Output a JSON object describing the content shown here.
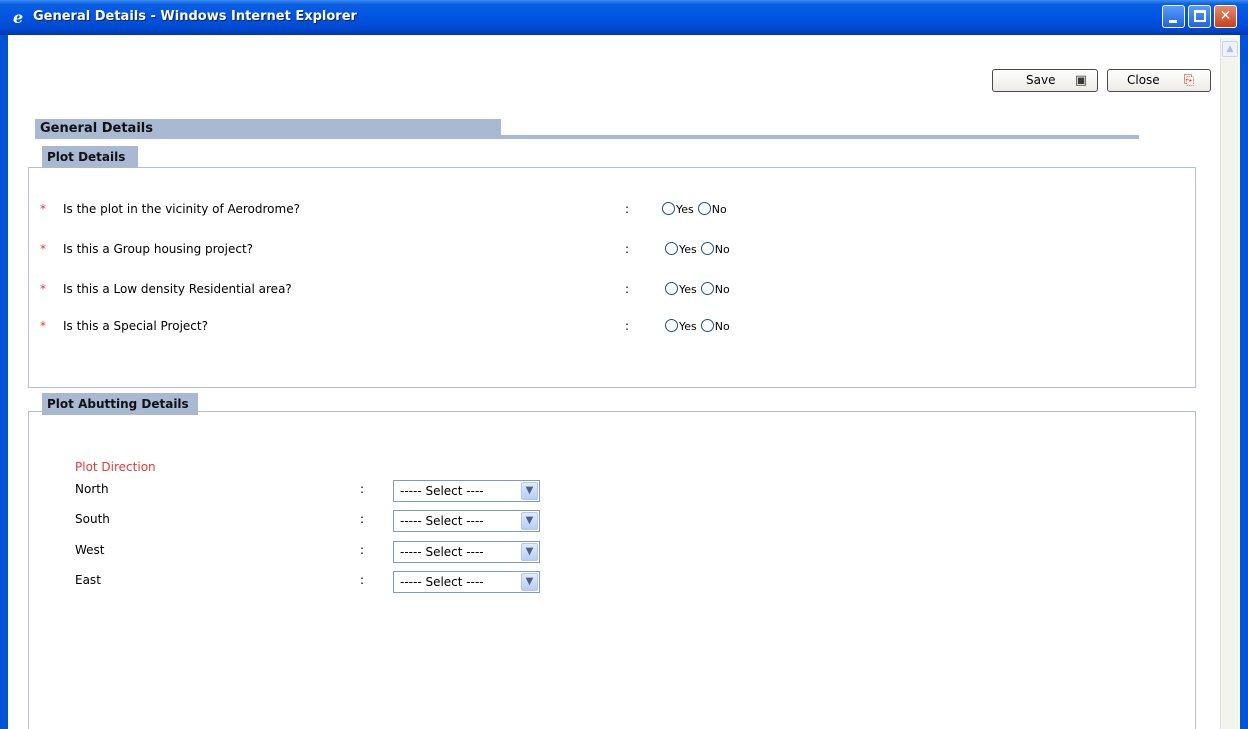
{
  "window": {
    "title": "General Details - Windows Internet Explorer",
    "minimize_glyph": "",
    "maximize_glyph": "",
    "close_glyph": "✕"
  },
  "toolbar": {
    "save_label": "Save",
    "close_label": "Close"
  },
  "section": {
    "title": "General Details"
  },
  "plot_details": {
    "legend": "Plot Details",
    "questions": [
      {
        "text": "Is the plot in the vicinity of Aerodrome?",
        "options": [
          "Yes",
          "No"
        ]
      },
      {
        "text": "Is this a Group housing project?",
        "options": [
          "Yes",
          "No"
        ]
      },
      {
        "text": "Is this a Low density Residential area?",
        "options": [
          "Yes",
          "No"
        ]
      },
      {
        "text": "Is this a Special Project?",
        "options": [
          "Yes",
          "No"
        ]
      }
    ],
    "required_marker": "*",
    "separator": ":"
  },
  "plot_abutting": {
    "legend": "Plot Abutting Details",
    "direction_title": "Plot Direction",
    "rows": [
      {
        "label": "North",
        "value": "----- Select ----"
      },
      {
        "label": "South",
        "value": "----- Select ----"
      },
      {
        "label": "West",
        "value": "----- Select ----"
      },
      {
        "label": "East",
        "value": "----- Select ----"
      }
    ],
    "separator": ":"
  },
  "colors": {
    "titlebar": "#0054e3",
    "section_header": "#a9b9d3",
    "required": "#e83a3a",
    "box_border": "#b3c0d8"
  }
}
